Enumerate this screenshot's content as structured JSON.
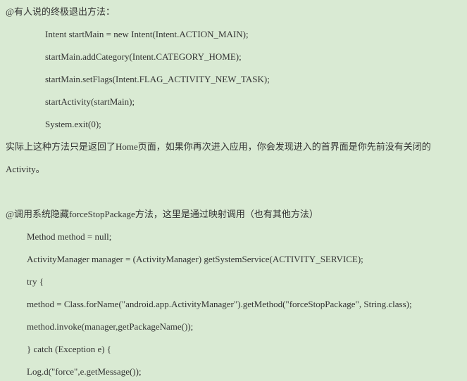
{
  "section1": {
    "heading": "@有人说的终极退出方法：",
    "code": [
      "Intent startMain = new Intent(Intent.ACTION_MAIN);",
      "startMain.addCategory(Intent.CATEGORY_HOME);",
      "startMain.setFlags(Intent.FLAG_ACTIVITY_NEW_TASK);",
      "startActivity(startMain);",
      "System.exit(0);"
    ],
    "note_line1": "实际上这种方法只是返回了Home页面，如果你再次进入应用，你会发现进入的首界面是你先前没有关闭的",
    "note_line2": "Activity。"
  },
  "section2": {
    "heading": "@调用系统隐藏forceStopPackage方法，这里是通过映射调用（也有其他方法）",
    "code": [
      "Method method = null;",
      "ActivityManager manager = (ActivityManager) getSystemService(ACTIVITY_SERVICE);",
      "try {",
      " method = Class.forName(\"android.app.ActivityManager\").getMethod(\"forceStopPackage\", String.class);",
      " method.invoke(manager,getPackageName());",
      " } catch (Exception e) {",
      "  Log.d(\"force\",e.getMessage());"
    ]
  }
}
